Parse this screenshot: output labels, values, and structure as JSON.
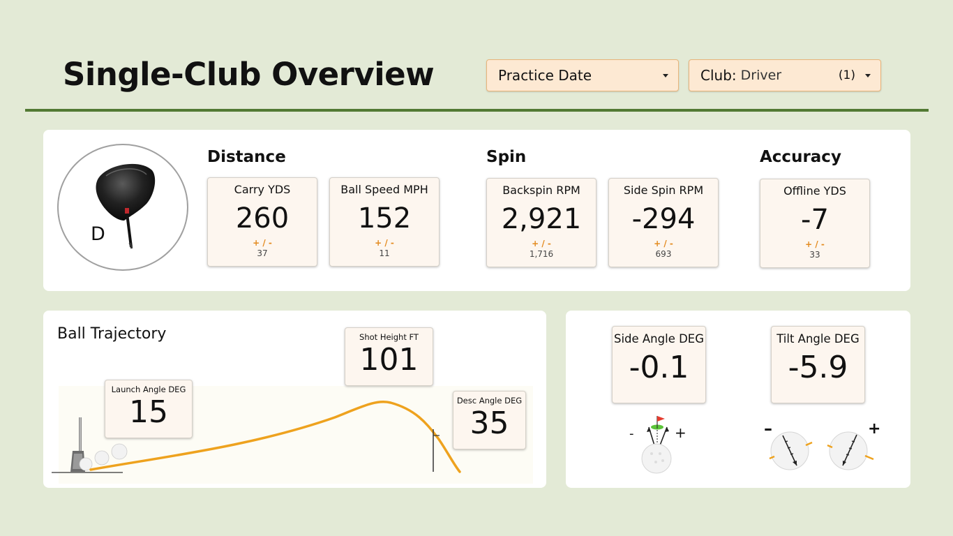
{
  "header": {
    "title": "Single-Club Overview",
    "date_dropdown": {
      "label": "Practice Date"
    },
    "club_dropdown": {
      "label": "Club:",
      "value": "Driver",
      "count": "(1)"
    }
  },
  "club": {
    "letter": "D",
    "image": "driver-club-head"
  },
  "sections": {
    "distance": "Distance",
    "spin": "Spin",
    "accuracy": "Accuracy"
  },
  "plusminus": "+ / -",
  "metrics": {
    "carry": {
      "label": "Carry YDS",
      "value": "260",
      "sd": "37"
    },
    "ball_speed": {
      "label": "Ball Speed MPH",
      "value": "152",
      "sd": "11"
    },
    "backspin": {
      "label": "Backspin RPM",
      "value": "2,921",
      "sd": "1,716"
    },
    "side_spin": {
      "label": "Side Spin RPM",
      "value": "-294",
      "sd": "693"
    },
    "offline": {
      "label": "Offline YDS",
      "value": "-7",
      "sd": "33"
    }
  },
  "trajectory": {
    "title": "Ball Trajectory",
    "launch": {
      "label": "Launch Angle DEG",
      "value": "15"
    },
    "height": {
      "label": "Shot Height FT",
      "value": "101"
    },
    "descent": {
      "label": "Desc Angle DEG",
      "value": "35"
    }
  },
  "angles": {
    "side": {
      "label": "Side Angle DEG",
      "value": "-0.1",
      "minus": "-",
      "plus": "+"
    },
    "tilt": {
      "label": "Tilt Angle DEG",
      "value": "-5.9",
      "minus": "–",
      "plus": "+"
    }
  },
  "colors": {
    "accent": "#e38a1e",
    "rule": "#527a33",
    "card_bg": "#fdf6ef",
    "dropdown_bg": "#fde9d3",
    "page_bg": "#e3ead6",
    "trajectory": "#eea21e"
  }
}
